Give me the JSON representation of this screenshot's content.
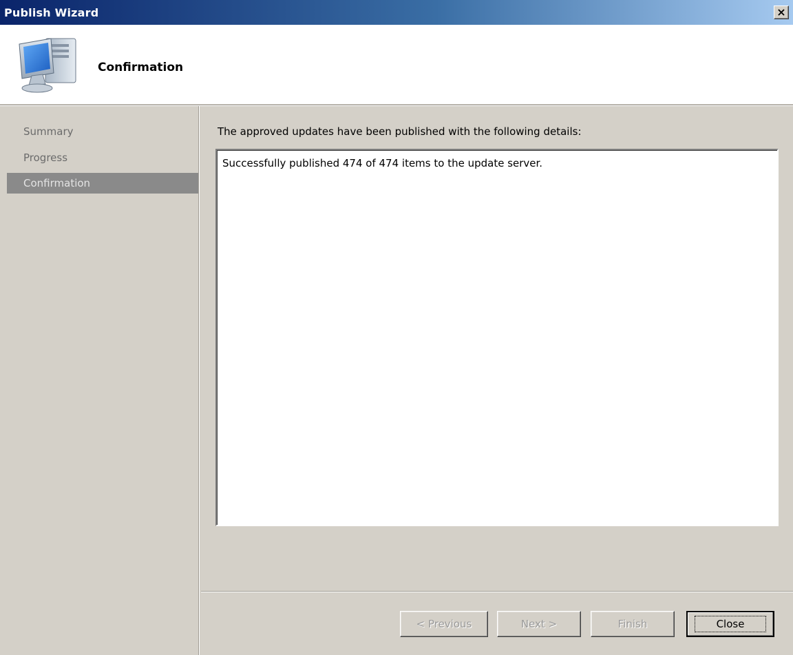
{
  "window": {
    "title": "Publish Wizard",
    "close_glyph": "×"
  },
  "header": {
    "title": "Confirmation",
    "icon": "computer-monitor-icon"
  },
  "sidebar": {
    "items": [
      {
        "label": "Summary",
        "active": false
      },
      {
        "label": "Progress",
        "active": false
      },
      {
        "label": "Confirmation",
        "active": true
      }
    ]
  },
  "main": {
    "instruction": "The approved updates have been published with the following details:",
    "details": "Successfully published 474 of 474 items to the update server."
  },
  "buttons": {
    "previous": "< Previous",
    "next": "Next >",
    "finish": "Finish",
    "close": "Close"
  },
  "colors": {
    "title_gradient_start": "#0a246a",
    "title_gradient_end": "#a6caf0",
    "active_nav_bg": "#8a8a8a",
    "dialog_bg": "#d4d0c8"
  }
}
